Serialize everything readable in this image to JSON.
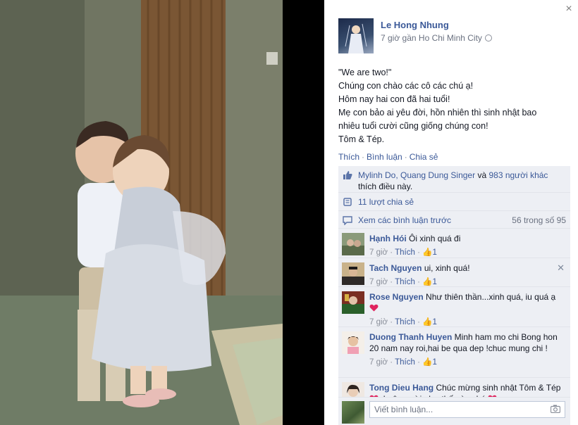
{
  "viewer": {
    "close_label": "×"
  },
  "post": {
    "author": "Le Hong Nhung",
    "meta": "7 giờ gần Ho Chi Minh City",
    "caption_lines": [
      "\"We are two!\"",
      "Chúng con chào các cô các chú ạ!",
      "Hôm nay hai con đã hai tuổi!",
      "Mẹ con bảo ai yêu đời, hồn nhiên thì sinh nhật bao",
      "nhiêu tuổi cười cũng giống chúng con!",
      "Tôm & Tép."
    ],
    "actions": {
      "like": "Thích",
      "comment": "Bình luận",
      "share": "Chia sẻ",
      "sep": "·"
    }
  },
  "ufi": {
    "likes": {
      "names": "Mylinh Do, Quang Dung Singer",
      "and": "và",
      "others": "983 người khác",
      "suffix": "thích điều này."
    },
    "shares": "11 lượt chia sẻ",
    "view_more": "Xem các bình luận trước",
    "count": "56 trong số 95",
    "comments": [
      {
        "name": "Hạnh Hói",
        "text": "Ôi xinh quá đi",
        "time": "7 giờ",
        "like": "Thích",
        "likes": "1"
      },
      {
        "name": "Tach Nguyen",
        "text": "ui, xinh quá!",
        "time": "7 giờ",
        "like": "Thích",
        "likes": "1",
        "delete": "✕"
      },
      {
        "name": "Rose Nguyen",
        "text": "Như thiên thần...xinh quá, iu quá ạ",
        "time": "7 giờ",
        "like": "Thích",
        "likes": "1"
      },
      {
        "name": "Duong Thanh Huyen",
        "text": "Minh ham mo chi Bong hon 20 nam nay roi,hai be qua dep !chuc mung chi !",
        "time": "7 giờ",
        "like": "Thích",
        "likes": "1"
      },
      {
        "name": "Tong Dieu Hang",
        "text": "Chúc mừng sinh nhật Tôm & Tép",
        "text2": ". Luôn cười như thế này nhé"
      }
    ],
    "write_placeholder": "Viết bình luận..."
  },
  "colors": {
    "link": "#3b5998",
    "panel_bg": "#edeff4",
    "heart": "#e0245e"
  }
}
